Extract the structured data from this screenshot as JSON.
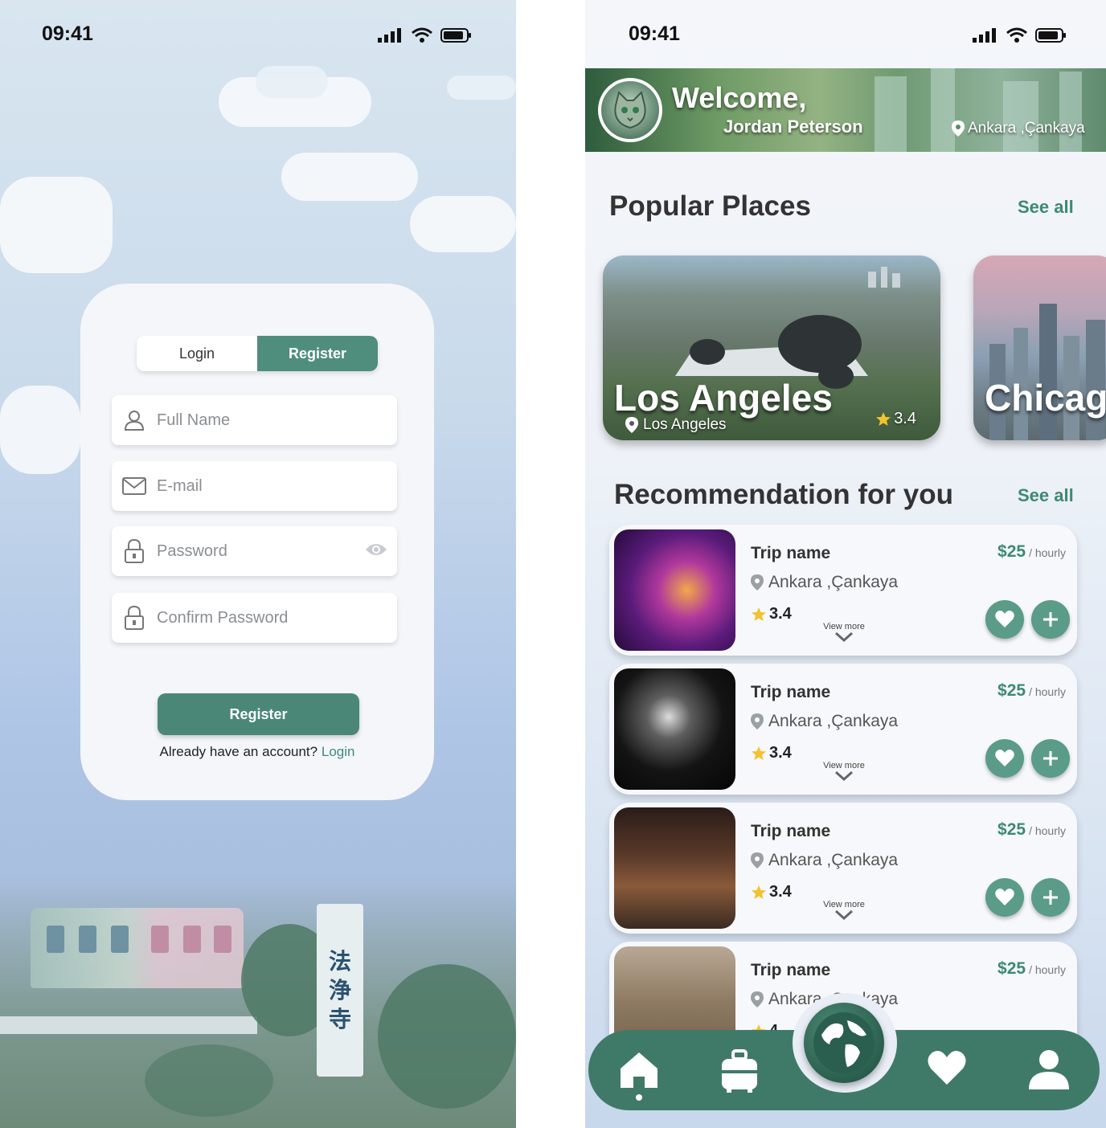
{
  "left_screen": {
    "status": {
      "time": "09:41"
    },
    "tabs": {
      "login": "Login",
      "register": "Register"
    },
    "fields": {
      "full_name": "Full Name",
      "email": "E-mail",
      "password": "Password",
      "confirm_password": "Confirm Password"
    },
    "register_button": "Register",
    "already_text": "Already have an account?",
    "login_link": "Login",
    "sign_text": [
      "法",
      "浄",
      "寺"
    ]
  },
  "right_screen": {
    "status": {
      "time": "09:41"
    },
    "header": {
      "welcome": "Welcome,",
      "user_name": "Jordan Peterson",
      "location": "Ankara ,Çankaya"
    },
    "popular": {
      "title": "Popular Places",
      "see_all": "See all",
      "places": [
        {
          "name": "Los Angeles",
          "location": "Los Angeles",
          "rating": "3.4"
        },
        {
          "name": "Chicag",
          "location": "",
          "rating": ""
        }
      ]
    },
    "recommendation": {
      "title": "Recommendation for you",
      "see_all": "See all",
      "items": [
        {
          "name": "Trip name",
          "location": "Ankara ,Çankaya",
          "rating": "3.4",
          "price": "$25",
          "unit": "/ hourly",
          "view_more": "View more"
        },
        {
          "name": "Trip name",
          "location": "Ankara ,Çankaya",
          "rating": "3.4",
          "price": "$25",
          "unit": "/ hourly",
          "view_more": "View more"
        },
        {
          "name": "Trip name",
          "location": "Ankara ,Çankaya",
          "rating": "3.4",
          "price": "$25",
          "unit": "/ hourly",
          "view_more": "View more"
        },
        {
          "name": "Trip name",
          "location": "Ankara ,Çankaya",
          "rating": "4",
          "price": "$25",
          "unit": "/ hourly",
          "view_more": ""
        }
      ]
    },
    "nav": {
      "icons": [
        "home-icon",
        "luggage-icon",
        "globe-icon",
        "heart-icon",
        "profile-icon"
      ],
      "active": "home-icon"
    },
    "colors": {
      "accent": "#4a8777",
      "price": "#3d8a71",
      "nav": "#3f7a68"
    }
  }
}
